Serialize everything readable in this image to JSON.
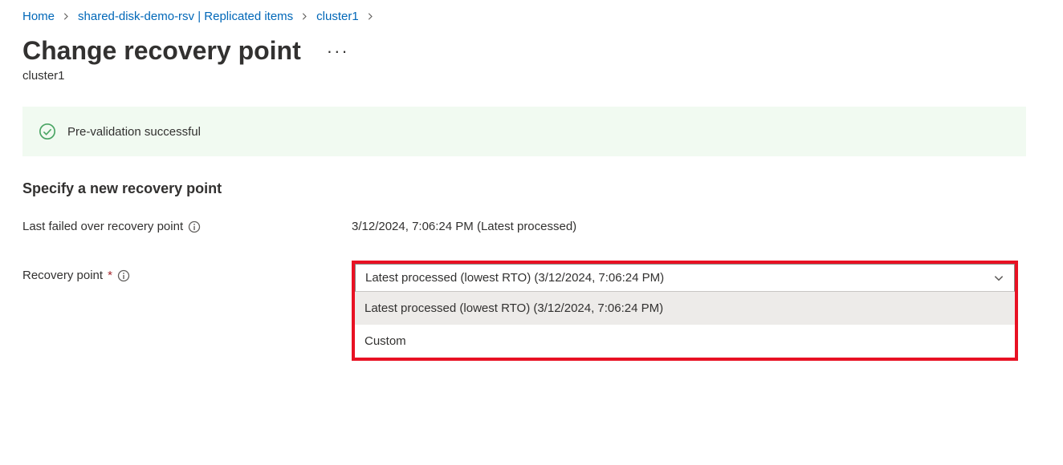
{
  "breadcrumb": {
    "home": "Home",
    "vault": "shared-disk-demo-rsv | Replicated items",
    "item": "cluster1"
  },
  "page": {
    "title": "Change recovery point",
    "subtitle": "cluster1"
  },
  "banner": {
    "message": "Pre-validation successful"
  },
  "section": {
    "heading": "Specify a new recovery point"
  },
  "fields": {
    "lastFailedOver": {
      "label": "Last failed over recovery point",
      "value": "3/12/2024, 7:06:24 PM (Latest processed)"
    },
    "recoveryPoint": {
      "label": "Recovery point",
      "selected": "Latest processed (lowest RTO) (3/12/2024, 7:06:24 PM)",
      "options": [
        "Latest processed (lowest RTO) (3/12/2024, 7:06:24 PM)",
        "Custom"
      ]
    }
  }
}
